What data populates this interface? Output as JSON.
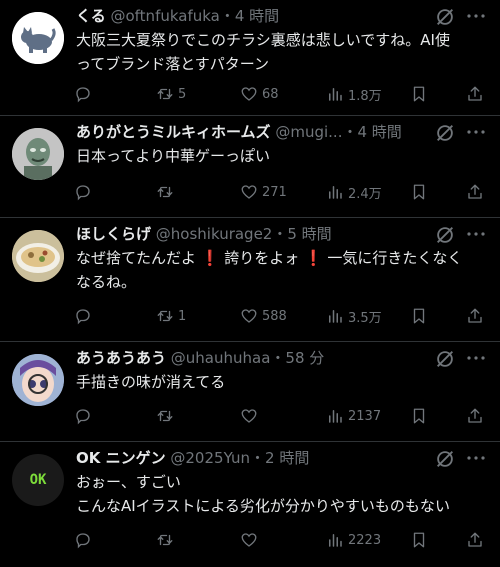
{
  "tweets": [
    {
      "name": "くる",
      "meta": "@oftnfukafuka・4 時間",
      "lines": [
        "大阪三大夏祭りでこのチラシ裏感は悲しいですね。AI使",
        "ってブランド落とすパターン"
      ],
      "reply": "",
      "retweet": "5",
      "like": "68",
      "views": "1.8万",
      "avatar": "cat-avatar"
    },
    {
      "name": "ありがとうミルキィホームズ",
      "meta": "@mugi...・4 時間",
      "lines": [
        "日本ってより中華ゲーっぽい"
      ],
      "reply": "",
      "retweet": "",
      "like": "271",
      "views": "2.4万",
      "avatar": "character-avatar"
    },
    {
      "name": "ほしくらげ",
      "meta": "@hoshikurage2・5 時間",
      "lines": [
        "なぜ捨てたんだよ ❗ 誇りをよォ ❗ 一気に行きたくなく",
        "なるね。"
      ],
      "reply": "",
      "retweet": "1",
      "like": "588",
      "views": "3.5万",
      "avatar": "food-avatar"
    },
    {
      "name": "あうあうあう",
      "meta": "@uhauhuhaa・58 分",
      "lines": [
        "手描きの味が消えてる"
      ],
      "reply": "",
      "retweet": "",
      "like": "",
      "views": "2137",
      "avatar": "anime-avatar"
    },
    {
      "name": "OK ニンゲン",
      "meta": "@2025Yun・2 時間",
      "lines": [
        "おぉー、すごい",
        "こんなAIイラストによる劣化が分かりやすいものもない"
      ],
      "reply": "",
      "retweet": "",
      "like": "",
      "views": "2223",
      "avatar": "ok-avatar",
      "avatar_text": "OK"
    }
  ],
  "colors": {
    "background": "#000000",
    "text": "#e7e9ea",
    "secondary": "#71767b",
    "divider": "#2f3336",
    "ok_green": "#7ddc3a"
  },
  "icons": [
    "reply-icon",
    "retweet-icon",
    "like-icon",
    "views-icon",
    "bookmark-icon",
    "share-icon",
    "grok-icon",
    "more-icon"
  ]
}
